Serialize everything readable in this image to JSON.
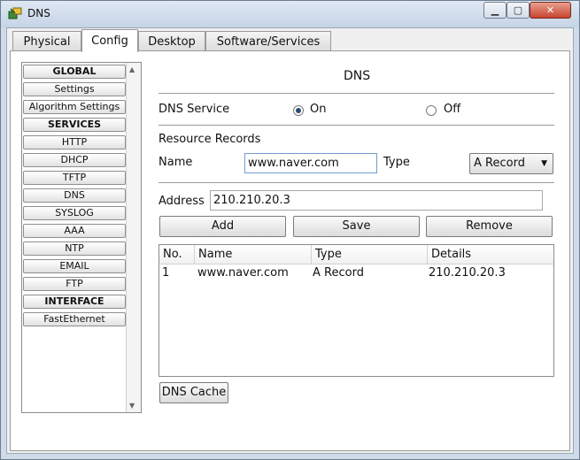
{
  "window": {
    "title": "DNS",
    "controls": {
      "minimize": "▁",
      "maximize": "▢",
      "close": "✕"
    }
  },
  "tabs": [
    "Physical",
    "Config",
    "Desktop",
    "Software/Services"
  ],
  "sidebar": {
    "items": [
      {
        "label": "GLOBAL",
        "header": true
      },
      {
        "label": "Settings"
      },
      {
        "label": "Algorithm Settings"
      },
      {
        "label": "SERVICES",
        "header": true
      },
      {
        "label": "HTTP"
      },
      {
        "label": "DHCP"
      },
      {
        "label": "TFTP"
      },
      {
        "label": "DNS"
      },
      {
        "label": "SYSLOG"
      },
      {
        "label": "AAA"
      },
      {
        "label": "NTP"
      },
      {
        "label": "EMAIL"
      },
      {
        "label": "FTP"
      },
      {
        "label": "INTERFACE",
        "header": true
      },
      {
        "label": "FastEthernet"
      }
    ]
  },
  "dns": {
    "title": "DNS",
    "service_label": "DNS Service",
    "on_label": "On",
    "off_label": "Off",
    "service_state": "On",
    "resource_records_label": "Resource Records",
    "name_label": "Name",
    "name_value": "www.naver.com",
    "type_label": "Type",
    "type_value": "A Record",
    "address_label": "Address",
    "address_value": "210.210.20.3",
    "add_button": "Add",
    "save_button": "Save",
    "remove_button": "Remove",
    "table": {
      "columns": [
        "No.",
        "Name",
        "Type",
        "Details"
      ],
      "rows": [
        [
          "1",
          "www.naver.com",
          "A Record",
          "210.210.20.3"
        ]
      ]
    },
    "dns_cache_button": "DNS Cache"
  },
  "colors": {
    "titlebar": "#cfdbe8",
    "close_button": "#c7452f",
    "radio_selected": "#2c4a74"
  }
}
